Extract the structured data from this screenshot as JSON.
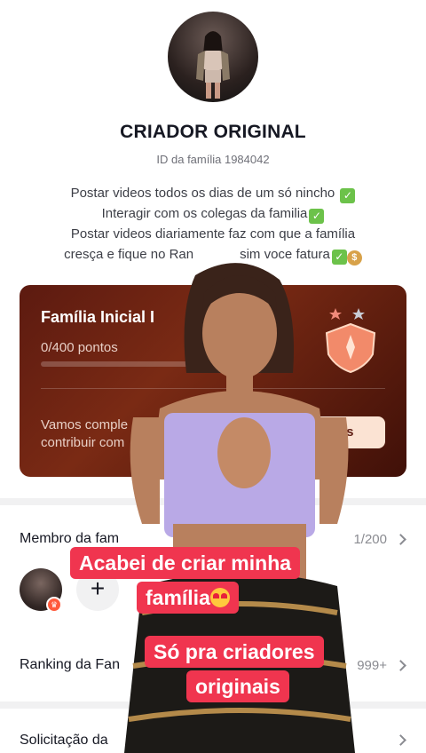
{
  "profile": {
    "title": "CRIADOR ORIGINAL",
    "family_id": "ID da família 1984042",
    "bio_lines": [
      "Postar videos todos os dias de um só nincho",
      "Interagir com os colegas da familia",
      "Postar videos diariamente faz com que a família",
      "cresça e fique no Ran",
      "sim voce fatura"
    ]
  },
  "family_card": {
    "title": "Família Inicial I",
    "points": "0/400 pontos",
    "progress": 0,
    "description_line1": "Vamos comple",
    "description_line2": "contribuir com",
    "button_label": "Pontos",
    "colors": {
      "background": "#5c1a10",
      "button": "#fbe3d3"
    }
  },
  "rows": {
    "members_label": "Membro da fam",
    "members_count": "1/200",
    "ranking_label": "Ranking da Fan",
    "ranking_value": "999+",
    "request_label": "Solicitação da"
  },
  "captions": {
    "line1": "Acabei de criar minha",
    "line2": "família",
    "line3": "Só pra criadores",
    "line4": "originais"
  },
  "icons": {
    "check": "check-emoji-icon",
    "money_bag": "money-bag-icon",
    "badge": "shield-badge-icon",
    "add": "plus-icon",
    "heart_eyes": "heart-eyes-emoji-icon"
  },
  "accent_colors": {
    "caption_bg": "#f0354f"
  }
}
